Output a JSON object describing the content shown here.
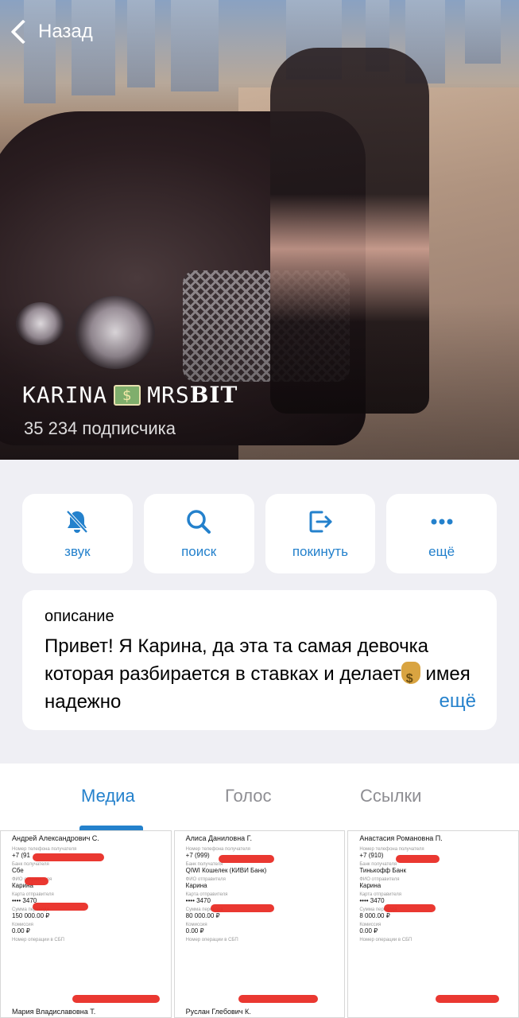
{
  "header": {
    "back_label": "Назад",
    "title_left": "KARINA",
    "title_right_plain": "MRS",
    "title_right_bold": "BIT",
    "subscribers": "35 234 подписчика"
  },
  "actions": [
    {
      "label": "звук",
      "icon": "bell-slash-icon"
    },
    {
      "label": "поиск",
      "icon": "search-icon"
    },
    {
      "label": "покинуть",
      "icon": "leave-icon"
    },
    {
      "label": "ещё",
      "icon": "more-icon"
    }
  ],
  "description": {
    "caption": "описание",
    "text_1": "Привет! Я Карина, да эта та самая девочка которая разбирается в ставках и делает",
    "text_2": " имея надежно",
    "more": "ещё"
  },
  "tabs": [
    {
      "label": "Медиа",
      "active": true
    },
    {
      "label": "Голос",
      "active": false
    },
    {
      "label": "Ссылки",
      "active": false
    }
  ],
  "media": [
    {
      "name": "Андрей Александрович С.",
      "phone_label": "Номер телефона получателя",
      "phone": "+7 (91",
      "bank_label": "Банк получателя",
      "bank": "Сбе",
      "sender_label": "ФИО отправителя",
      "sender": "Карина",
      "card_label": "Карта отправителя",
      "card": "•••• 3470",
      "sum_label": "Сумма перевода",
      "sum": "150 000.00 ₽",
      "fee_label": "Комиссия",
      "fee": "0.00 ₽",
      "op_label": "Номер операции в СБП",
      "next": "Мария Владиславовна Т."
    },
    {
      "name": "Алиса Даниловна Г.",
      "phone_label": "Номер телефона получателя",
      "phone": "+7 (999)",
      "bank_label": "Банк получателя",
      "bank": "QIWI Кошелек (КИВИ Банк)",
      "sender_label": "ФИО отправителя",
      "sender": "Карина",
      "card_label": "Карта отправителя",
      "card": "•••• 3470",
      "sum_label": "Сумма перевода",
      "sum": "80 000.00 ₽",
      "fee_label": "Комиссия",
      "fee": "0.00 ₽",
      "op_label": "Номер операции в СБП",
      "next": "Руслан Глебович К."
    },
    {
      "name": "Анастасия Романовна П.",
      "phone_label": "Номер телефона получателя",
      "phone": "+7 (910)",
      "bank_label": "Банк получателя",
      "bank": "Тинькофф Банк",
      "sender_label": "ФИО отправителя",
      "sender": "Карина",
      "card_label": "Карта отправителя",
      "card": "•••• 3470",
      "sum_label": "Сумма перевода",
      "sum": "8 000.00 ₽",
      "fee_label": "Комиссия",
      "fee": "0.00 ₽",
      "op_label": "Номер операции в СБП",
      "next": ""
    }
  ],
  "colors": {
    "accent": "#2481cc",
    "background": "#efeff4",
    "redaction": "#e8271f"
  }
}
